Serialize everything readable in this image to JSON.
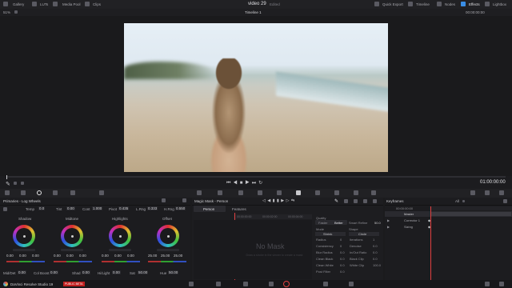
{
  "topbar": {
    "gallery": "Gallery",
    "luts": "LUTs",
    "media_pool": "Media Pool",
    "clips": "Clips",
    "project_title": "video 29",
    "edited": "Edited",
    "quick_export": "Quick Export",
    "timeline": "Timeline",
    "nodes": "Nodes",
    "effects": "Effects",
    "lightbox": "Lightbox"
  },
  "viewer_header": {
    "zoom": "51%",
    "timeline_name": "Timeline 1",
    "timecode": "00:00:00:00"
  },
  "transport": {
    "timecode": "01:00:00:00"
  },
  "primaries": {
    "title": "Primaries - Log Wheels",
    "temp_label": "Temp",
    "temp_value": "0.0",
    "tint_label": "Tint",
    "tint_value": "0.00",
    "cont_label": "Cont",
    "cont_value": "1.000",
    "pivot_label": "Pivot",
    "pivot_value": "0.435",
    "lowrange_label": "L.Rng",
    "lowrange_value": "0.333",
    "highrange_label": "H.Rng",
    "highrange_value": "0.550",
    "wheels": [
      {
        "label": "Shadow",
        "values": [
          "0.00",
          "0.00",
          "0.00"
        ]
      },
      {
        "label": "Midtone",
        "values": [
          "0.00",
          "0.00",
          "0.00"
        ]
      },
      {
        "label": "Highlights",
        "values": [
          "0.00",
          "0.00",
          "0.00"
        ]
      },
      {
        "label": "Offset",
        "values": [
          "25.00",
          "25.00",
          "25.00"
        ]
      }
    ],
    "bottom": {
      "middetail_label": "Mid/Det",
      "middetail_value": "0.00",
      "colboost_label": "Col Boost",
      "colboost_value": "0.00",
      "shad_label": "Shad",
      "shad_value": "0.00",
      "hilight_label": "Hi/Light",
      "hilight_value": "0.00",
      "sat_label": "Sat",
      "sat_value": "50.00",
      "hue_label": "Hue",
      "hue_value": "50.00"
    }
  },
  "magic_mask": {
    "title": "Magic Mask - Person",
    "tab_person": "Person",
    "tab_features": "Features",
    "ruler": [
      "00:00:00:00",
      "00:00:02:00",
      "00:00:04:00"
    ],
    "no_mask": "No Mask",
    "hint": "Draw a stroke in the viewer to create a mask",
    "quality_label": "Quality",
    "quality_faster": "Faster",
    "quality_better": "Better",
    "smart_refine_label": "Smart Refine",
    "smart_refine_value": "50.0",
    "mode_label": "Mode",
    "mode_value": "Shrink",
    "shape_label": "Shape",
    "shape_value": "Circle",
    "rows": [
      {
        "l": "Radius",
        "v": "0",
        "l2": "Iterations",
        "v2": "1"
      },
      {
        "l": "Consistency",
        "v": "0",
        "l2": "Denoise",
        "v2": "0.0"
      },
      {
        "l": "Blur Radius",
        "v": "0.0",
        "l2": "In/Out Ratio",
        "v2": "0.0"
      },
      {
        "l": "Clean Black",
        "v": "0.0",
        "l2": "Black Clip",
        "v2": "0.0"
      },
      {
        "l": "Clean White",
        "v": "0.0",
        "l2": "White Clip",
        "v2": "100.0"
      },
      {
        "l": "Post Filter",
        "v": "0.0",
        "l2": "",
        "v2": ""
      }
    ]
  },
  "keyframes": {
    "title": "Keyframes",
    "filter": "All",
    "timecode": "00:00:00:00",
    "tc_right": "01:00:00:00",
    "master": "Master",
    "items": [
      "Corrector 1",
      "Sizing"
    ]
  },
  "bottom_bar": {
    "app_name": "DaVinci Resolve Studio 19",
    "badge": "PUBLIC BETA"
  },
  "colors": {
    "accent": "#e04040",
    "active_blue": "#3a8ee6",
    "badge_bg": "#c02020"
  }
}
